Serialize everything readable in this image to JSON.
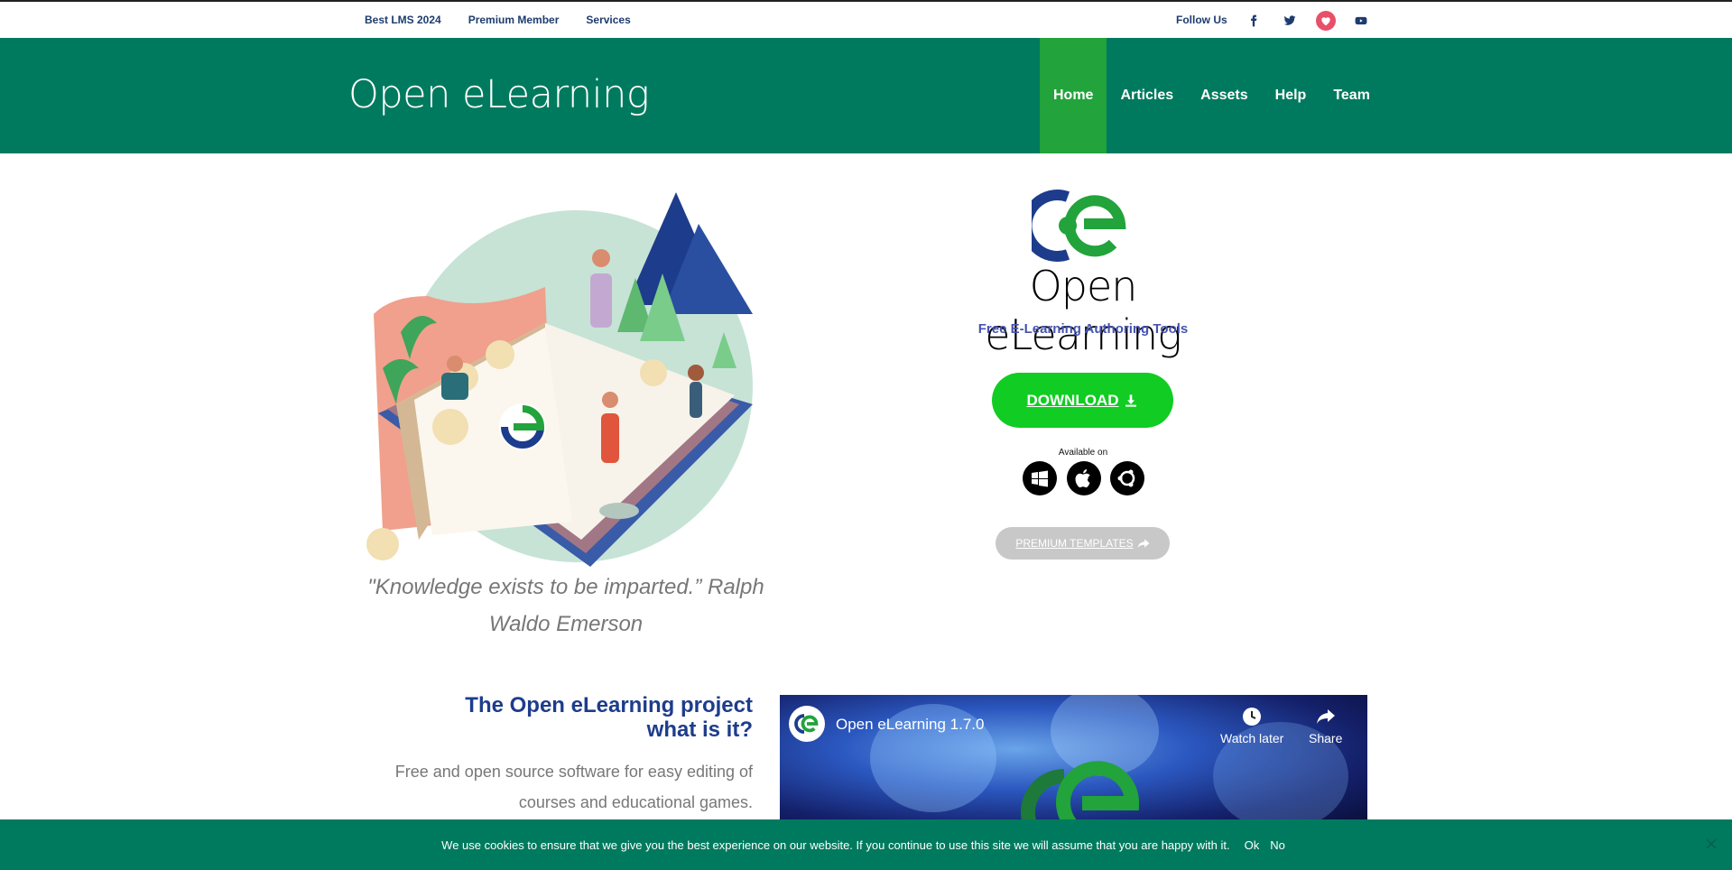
{
  "topbar": {
    "links": [
      "Best LMS 2024",
      "Premium Member",
      "Services"
    ],
    "follow_label": "Follow Us",
    "social_icons": [
      "facebook-icon",
      "twitter-icon",
      "heart-icon",
      "youtube-icon"
    ]
  },
  "header": {
    "logo": "Open eLearning",
    "nav": [
      {
        "label": "Home",
        "active": true
      },
      {
        "label": "Articles",
        "active": false
      },
      {
        "label": "Assets",
        "active": false
      },
      {
        "label": "Help",
        "active": false
      },
      {
        "label": "Team",
        "active": false
      }
    ]
  },
  "hero": {
    "quote": "\"Knowledge exists to be imparted.” Ralph Waldo Emerson"
  },
  "brand": {
    "name": "Open eLearning",
    "tagline": "Free E-Learning Authoring Tools",
    "download_label": "DOWNLOAD",
    "available_label": "Available on",
    "os_icons": [
      "windows-icon",
      "apple-icon",
      "ubuntu-icon"
    ],
    "premium_label": "PREMIUM TEMPLATES"
  },
  "project": {
    "title_line1": "The Open eLearning project",
    "title_line2": "what is it?",
    "description": "Free and open source software for easy editing of courses and educational games."
  },
  "video": {
    "title": "Open eLearning 1.7.0",
    "watch_later": "Watch later",
    "share": "Share"
  },
  "cookie": {
    "message": "We use cookies to ensure that we give you the best experience on our website. If you continue to use this site we will assume that you are happy with it.",
    "ok": "Ok",
    "no": "No"
  },
  "colors": {
    "header_green": "#007a5e",
    "nav_active": "#22a33b",
    "download_green": "#11cc22",
    "navy": "#1d3c8c",
    "tagline_blue": "#4754b0"
  }
}
